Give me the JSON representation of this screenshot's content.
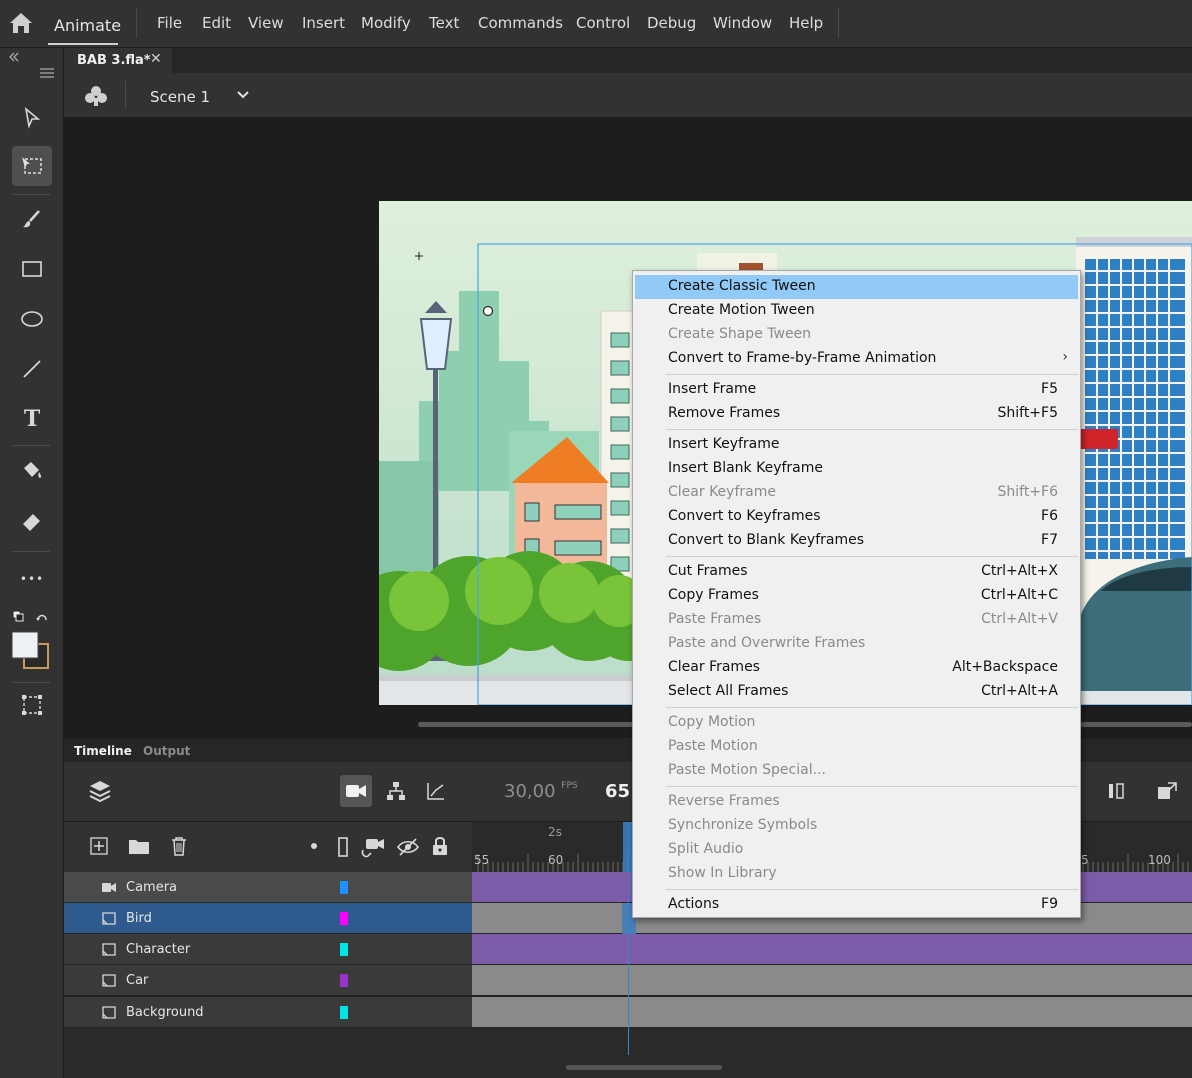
{
  "app": {
    "name": "Animate"
  },
  "menu": [
    "File",
    "Edit",
    "View",
    "Insert",
    "Modify",
    "Text",
    "Commands",
    "Control",
    "Debug",
    "Window",
    "Help"
  ],
  "document": {
    "tab_title": "BAB 3.fla*",
    "close_glyph": "✕"
  },
  "editbar": {
    "scene": "Scene 1"
  },
  "toolbar": {
    "tools": [
      "selection-tool-icon",
      "free-transform-tool-icon",
      "brush-tool-icon",
      "rectangle-tool-icon",
      "oval-tool-icon",
      "line-tool-icon",
      "text-tool-icon",
      "paint-bucket-tool-icon",
      "eraser-tool-icon",
      "more-tools-icon"
    ],
    "more_glyph": "•••",
    "text_tool_glyph": "T"
  },
  "timeline": {
    "tabs": [
      "Timeline",
      "Output"
    ],
    "fps_value": "30,00",
    "fps_unit": "FPS",
    "current_frame": "65",
    "ruler_second": "2s",
    "ruler_numbers": [
      "55",
      "60",
      "5",
      "100"
    ],
    "layers": [
      {
        "name": "Camera",
        "color": "#1e90ff",
        "type": "camera"
      },
      {
        "name": "Bird",
        "color": "#ff00ff",
        "type": "layer",
        "selected": true
      },
      {
        "name": "Character",
        "color": "#00e5e5",
        "type": "layer"
      },
      {
        "name": "Car",
        "color": "#9933cc",
        "type": "layer"
      },
      {
        "name": "Background",
        "color": "#00e5e5",
        "type": "layer"
      }
    ],
    "frame_colors": {
      "tween": "#7c5ca8",
      "keyframes": "#8a8a8a"
    }
  },
  "context_menu": {
    "groups": [
      [
        {
          "label": "Create Classic Tween",
          "shortcut": "",
          "enabled": true,
          "highlighted": true
        },
        {
          "label": "Create Motion Tween",
          "shortcut": "",
          "enabled": true
        },
        {
          "label": "Create Shape Tween",
          "shortcut": "",
          "enabled": false
        },
        {
          "label": "Convert to Frame-by-Frame Animation",
          "shortcut": "",
          "enabled": true,
          "submenu": true
        }
      ],
      [
        {
          "label": "Insert Frame",
          "shortcut": "F5",
          "enabled": true
        },
        {
          "label": "Remove Frames",
          "shortcut": "Shift+F5",
          "enabled": true
        }
      ],
      [
        {
          "label": "Insert Keyframe",
          "shortcut": "",
          "enabled": true
        },
        {
          "label": "Insert Blank Keyframe",
          "shortcut": "",
          "enabled": true
        },
        {
          "label": "Clear Keyframe",
          "shortcut": "Shift+F6",
          "enabled": false
        },
        {
          "label": "Convert to Keyframes",
          "shortcut": "F6",
          "enabled": true
        },
        {
          "label": "Convert to Blank Keyframes",
          "shortcut": "F7",
          "enabled": true
        }
      ],
      [
        {
          "label": "Cut Frames",
          "shortcut": "Ctrl+Alt+X",
          "enabled": true
        },
        {
          "label": "Copy Frames",
          "shortcut": "Ctrl+Alt+C",
          "enabled": true
        },
        {
          "label": "Paste Frames",
          "shortcut": "Ctrl+Alt+V",
          "enabled": false
        },
        {
          "label": "Paste and Overwrite Frames",
          "shortcut": "",
          "enabled": false
        },
        {
          "label": "Clear Frames",
          "shortcut": "Alt+Backspace",
          "enabled": true
        },
        {
          "label": "Select All Frames",
          "shortcut": "Ctrl+Alt+A",
          "enabled": true
        }
      ],
      [
        {
          "label": "Copy Motion",
          "shortcut": "",
          "enabled": false
        },
        {
          "label": "Paste Motion",
          "shortcut": "",
          "enabled": false
        },
        {
          "label": "Paste Motion Special...",
          "shortcut": "",
          "enabled": false
        }
      ],
      [
        {
          "label": "Reverse Frames",
          "shortcut": "",
          "enabled": false
        },
        {
          "label": "Synchronize Symbols",
          "shortcut": "",
          "enabled": false
        },
        {
          "label": "Split Audio",
          "shortcut": "",
          "enabled": false
        },
        {
          "label": "Show In Library",
          "shortcut": "",
          "enabled": false
        }
      ],
      [
        {
          "label": "Actions",
          "shortcut": "F9",
          "enabled": true
        }
      ]
    ],
    "submenu_glyph": "›"
  },
  "colors": {
    "accent": "#3b82c8",
    "highlight": "#91c9f7",
    "panel": "#323232"
  }
}
